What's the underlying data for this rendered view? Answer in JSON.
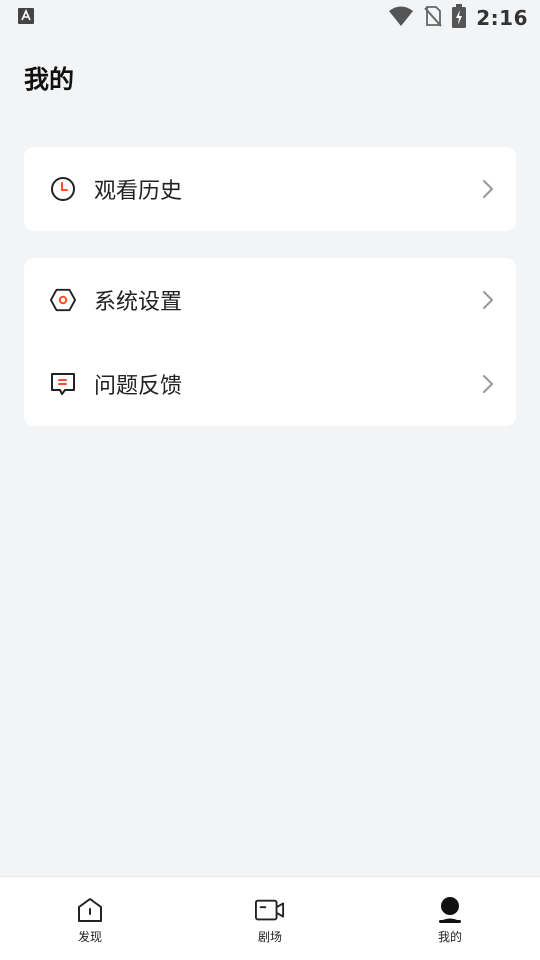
{
  "status_bar": {
    "time": "2:16",
    "left_icon": "a-accessibility-icon",
    "icons": [
      "wifi-icon",
      "no-sim-icon",
      "battery-charging-icon"
    ]
  },
  "page": {
    "title": "我的"
  },
  "menu": {
    "groups": [
      {
        "items": [
          {
            "label": "观看历史",
            "icon": "clock-icon"
          }
        ]
      },
      {
        "items": [
          {
            "label": "系统设置",
            "icon": "settings-hexagon-icon"
          },
          {
            "label": "问题反馈",
            "icon": "feedback-icon"
          }
        ]
      }
    ]
  },
  "bottom_nav": {
    "items": [
      {
        "label": "发现",
        "icon": "home-icon",
        "active": false
      },
      {
        "label": "剧场",
        "icon": "video-camera-icon",
        "active": false
      },
      {
        "label": "我的",
        "icon": "user-icon",
        "active": true
      }
    ]
  },
  "colors": {
    "background": "#f3f4f6",
    "card": "#ffffff",
    "accent": "#ff4d2d",
    "text": "#222222"
  }
}
